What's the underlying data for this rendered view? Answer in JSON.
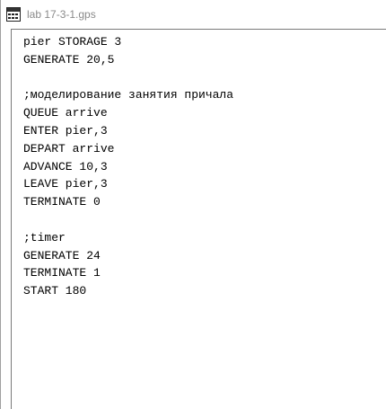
{
  "window": {
    "title": "lab 17-3-1.gps",
    "icon": "gpss-document-icon"
  },
  "editor": {
    "lines": [
      "pier STORAGE 3",
      "GENERATE 20,5",
      "",
      ";моделирование занятия причала",
      "QUEUE arrive",
      "ENTER pier,3",
      "DEPART arrive",
      "ADVANCE 10,3",
      "LEAVE pier,3",
      "TERMINATE 0",
      "",
      ";timer",
      "GENERATE 24",
      "TERMINATE 1",
      "START 180"
    ]
  }
}
